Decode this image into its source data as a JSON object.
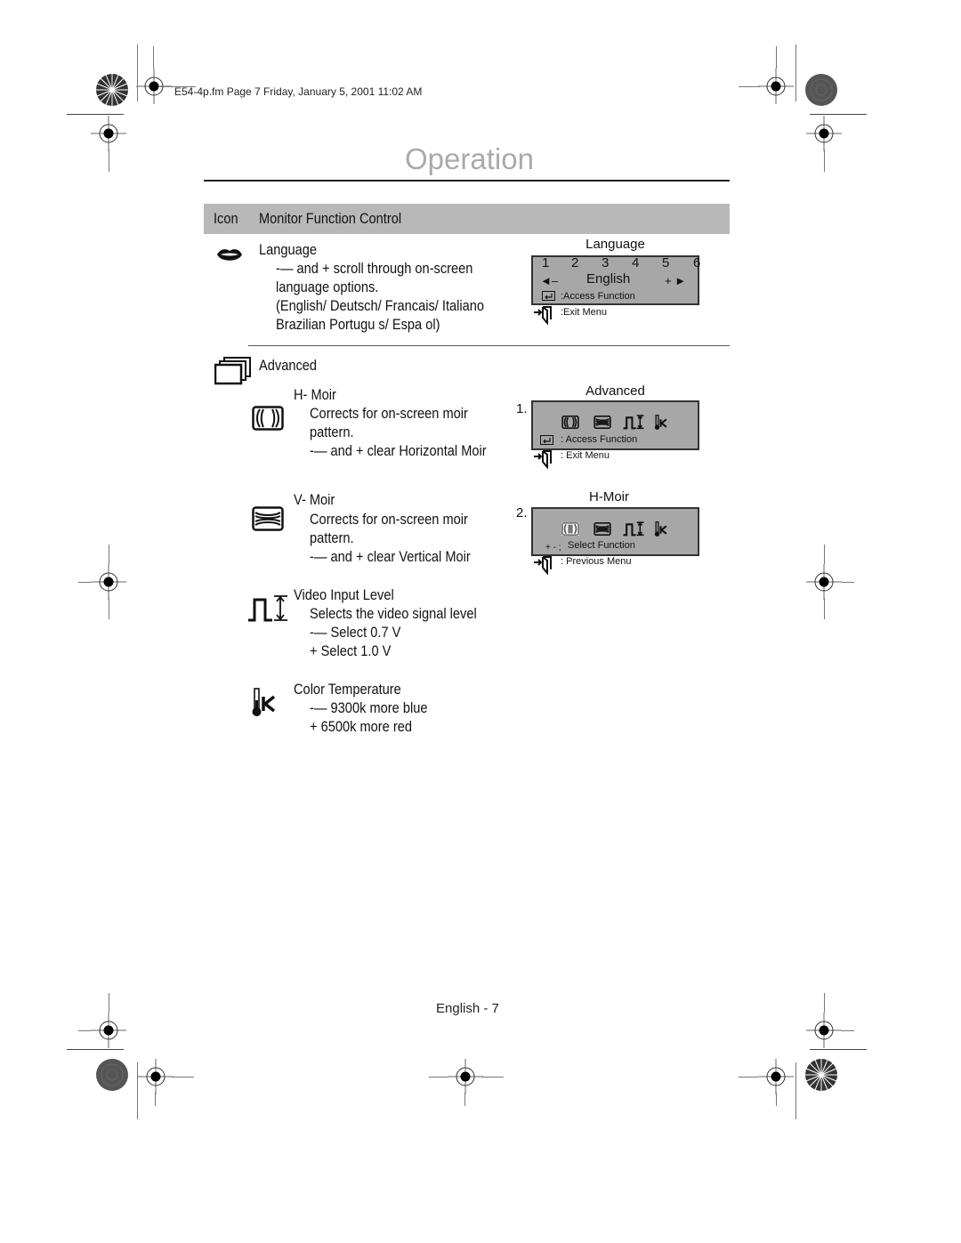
{
  "print_header": "E54-4p.fm  Page 7  Friday, January 5, 2001  11:02 AM",
  "page_title": "Operation",
  "table_header": {
    "icon_col": "Icon",
    "control_col": "Monitor Function Control"
  },
  "language_section": {
    "icon": "lips-icon",
    "heading": "Language",
    "lines": [
      "-— and + scroll through on-screen",
      "language options.",
      "(English/ Deutsch/ Francais/ Italiano",
      "Brazilian Portugu s/ Espa ol)"
    ],
    "osd": {
      "title": "Language",
      "numbers": [
        "1",
        "2",
        "3",
        "4",
        "5",
        "6"
      ],
      "left_control": "◄–",
      "value": "English",
      "right_control": "+ ►",
      "access_label": ":Access Function",
      "exit_label": ":Exit Menu"
    }
  },
  "advanced_section": {
    "icon": "stacked-windows-icon",
    "heading": "Advanced",
    "items": [
      {
        "icon": "h-moire-icon",
        "title": "H- Moir",
        "lines": [
          "Corrects for on-screen moir",
          "pattern.",
          "-— and + clear Horizontal Moir"
        ]
      },
      {
        "icon": "v-moire-icon",
        "title": "V- Moir",
        "lines": [
          "Corrects for on-screen moir",
          "pattern.",
          "-—  and + clear Vertical Moir"
        ]
      },
      {
        "icon": "video-level-icon",
        "title": "Video Input Level",
        "lines": [
          "Selects the video signal level",
          "-— Select 0.7 V",
          "+  Select 1.0 V"
        ]
      },
      {
        "icon": "thermometer-k-icon",
        "title": "Color Temperature",
        "lines": [
          "-—  9300k more blue",
          "+  6500k more red"
        ]
      }
    ],
    "osd_screens": [
      {
        "step": "1.",
        "title": "Advanced",
        "highlighted_index": -1,
        "line1_prefix": "",
        "line1": ": Access Function",
        "line2": ": Exit Menu"
      },
      {
        "step": "2.",
        "title": "H-Moir",
        "highlighted_index": 0,
        "line1_prefix": "+ - ;",
        "line1": "Select Function",
        "line2": ": Previous Menu"
      }
    ]
  },
  "footer": "English - 7"
}
